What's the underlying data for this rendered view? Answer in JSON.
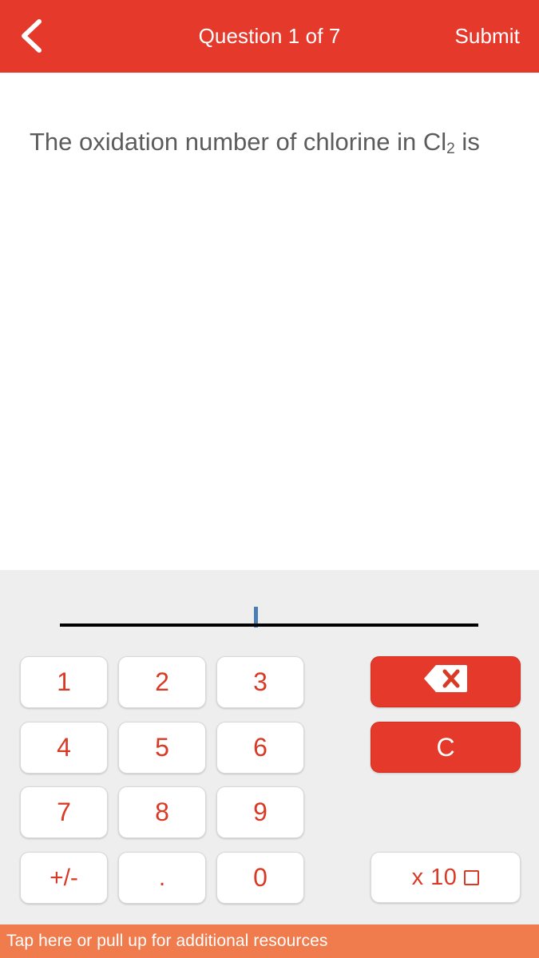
{
  "header": {
    "back_icon": "chevron-left-icon",
    "title": "Question 1 of 7",
    "submit_label": "Submit",
    "background_color": "#e4392b",
    "text_color": "#ffffff"
  },
  "question": {
    "text_before": "The oxidation number of chlorine in Cl",
    "subscript": "2",
    "text_after": " is",
    "text_color": "#5c5c5c"
  },
  "answer": {
    "value": "",
    "caret_visible": true,
    "caret_color": "#4a7fb5",
    "line_color": "#000000"
  },
  "keypad": {
    "background_color": "#eeeeee",
    "key_text_color": "#d93a26",
    "action_key_color": "#e4392b",
    "keys": [
      {
        "label": "1",
        "name": "key-1"
      },
      {
        "label": "2",
        "name": "key-2"
      },
      {
        "label": "3",
        "name": "key-3"
      },
      {
        "label": "4",
        "name": "key-4"
      },
      {
        "label": "5",
        "name": "key-5"
      },
      {
        "label": "6",
        "name": "key-6"
      },
      {
        "label": "7",
        "name": "key-7"
      },
      {
        "label": "8",
        "name": "key-8"
      },
      {
        "label": "9",
        "name": "key-9"
      },
      {
        "label": "+/-",
        "name": "key-plus-minus"
      },
      {
        "label": ".",
        "name": "key-decimal"
      },
      {
        "label": "0",
        "name": "key-0"
      }
    ],
    "backspace": {
      "label": "",
      "icon": "backspace-delete-icon",
      "name": "key-backspace"
    },
    "clear": {
      "label": "C",
      "name": "key-clear"
    },
    "scientific": {
      "label": "x 10",
      "exponent_placeholder": "□",
      "name": "key-x10-exponent"
    }
  },
  "footer": {
    "text": "Tap here or pull up for additional resources",
    "background_color": "#f07c4e",
    "text_color": "#ffffff"
  }
}
